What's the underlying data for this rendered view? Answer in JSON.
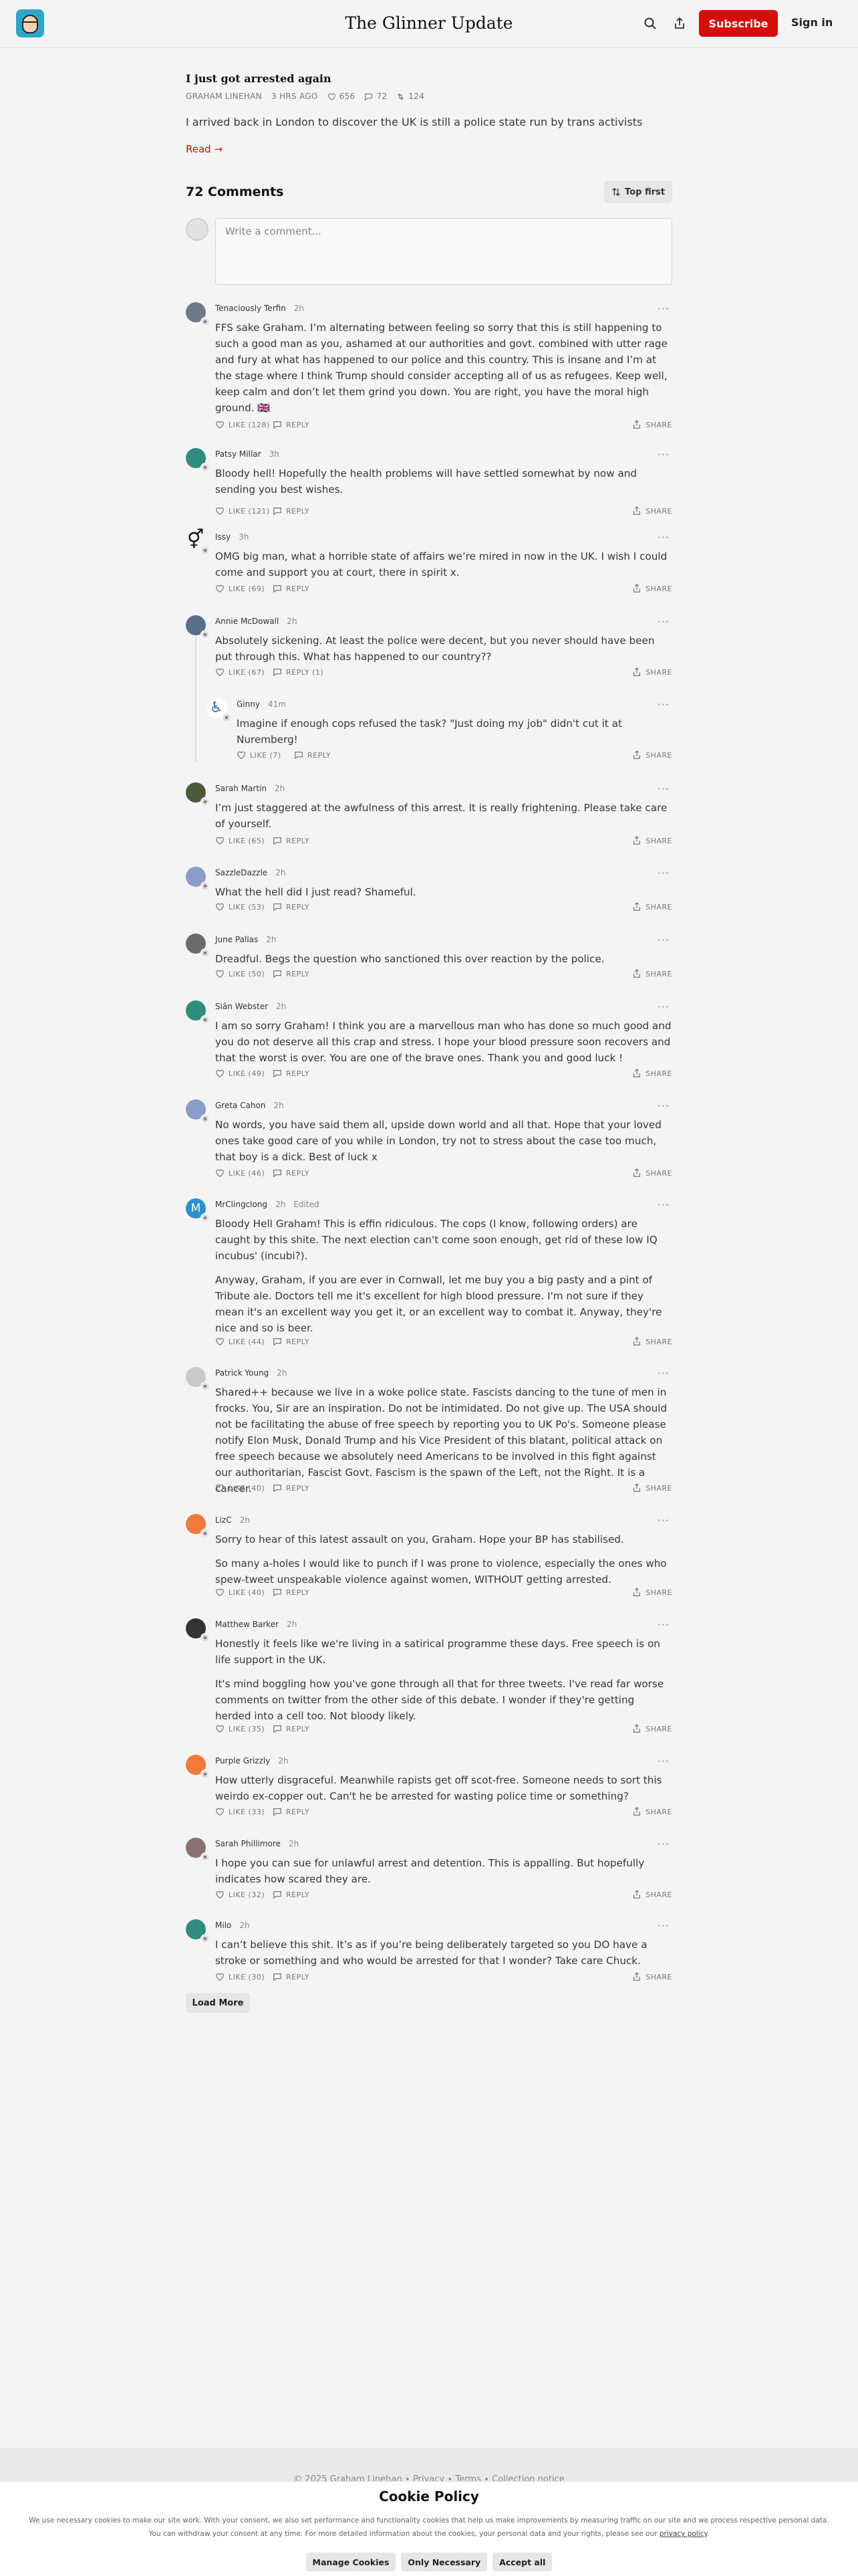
{
  "header": {
    "title": "The Glinner Update",
    "subscribe_label": "Subscribe",
    "signin_label": "Sign in"
  },
  "post": {
    "title": "I just got arrested again",
    "author": "GRAHAM LINEHAN",
    "time": "3 HRS AGO",
    "likes": "656",
    "comments": "72",
    "restacks": "124",
    "subtitle": "I arrived back in London to discover the UK is still a police state run by trans activists",
    "read_more": "Read →"
  },
  "comments_section": {
    "heading": "72 Comments",
    "sort_label": "Top first",
    "composer_placeholder": "Write a comment..."
  },
  "comments": [
    {
      "name": "Tenaciously Terfin",
      "time": "2h",
      "paragraphs": [
        "FFS sake Graham. I’m alternating between feeling so sorry that this is still happening to such a good man as you, ashamed at our authorities and govt. combined with utter rage and fury at what has happened to our police and this country. This is insane and I’m at the stage where I think Trump should consider accepting all of us as refugees. Keep well, keep calm and don’t let them grind you down. You are right, you have the moral high ground. 🇬🇧"
      ],
      "like": "LIKE (128)",
      "reply": "REPLY",
      "share": "SHARE"
    },
    {
      "name": "Patsy Millar",
      "time": "3h",
      "paragraphs": [
        "Bloody hell! Hopefully the health problems will have settled somewhat by now and sending you best wishes."
      ],
      "like": "LIKE (121)",
      "reply": "REPLY",
      "share": "SHARE"
    },
    {
      "name": "Issy",
      "time": "3h",
      "paragraphs": [
        "OMG big man, what a horrible state of affairs we’re mired in now in the UK. I wish I could come and support you at court, there in spirit x."
      ],
      "like": "LIKE (69)",
      "reply": "REPLY",
      "share": "SHARE"
    },
    {
      "name": "Annie McDowall",
      "time": "2h",
      "paragraphs": [
        "Absolutely sickening. At least the police were decent, but you never should have been put through this. What has happened to our country??"
      ],
      "like": "LIKE (67)",
      "reply": "REPLY (1)",
      "share": "SHARE"
    },
    {
      "name": "Ginny",
      "time": "41m",
      "paragraphs": [
        "Imagine if enough cops refused the task? \"Just doing my job\" didn't cut it at Nuremberg!"
      ],
      "like": "LIKE (7)",
      "reply": "REPLY",
      "share": "SHARE"
    },
    {
      "name": "Sarah Martin",
      "time": "2h",
      "paragraphs": [
        "I’m just staggered at the awfulness of this arrest. It is really frightening. Please take care of yourself."
      ],
      "like": "LIKE (65)",
      "reply": "REPLY",
      "share": "SHARE"
    },
    {
      "name": "SazzleDazzle",
      "time": "2h",
      "paragraphs": [
        "What the hell did I just read? Shameful."
      ],
      "like": "LIKE (53)",
      "reply": "REPLY",
      "share": "SHARE"
    },
    {
      "name": "June Pallas",
      "time": "2h",
      "paragraphs": [
        "Dreadful. Begs the question who sanctioned this over reaction by the police."
      ],
      "like": "LIKE (50)",
      "reply": "REPLY",
      "share": "SHARE"
    },
    {
      "name": "Siân Webster",
      "time": "2h",
      "paragraphs": [
        "I am so sorry Graham! I think you are a marvellous man who has done so much good and you do not deserve all this crap and stress. I hope your blood pressure soon recovers and that the worst is over. You are one of the brave ones. Thank you and good luck !"
      ],
      "like": "LIKE (49)",
      "reply": "REPLY",
      "share": "SHARE"
    },
    {
      "name": "Greta Cahon",
      "time": "2h",
      "paragraphs": [
        "No words, you have said them all, upside down world and all that. Hope that your loved ones take good care of you while in London, try not to stress about the case too much, that boy is a dick. Best of luck x"
      ],
      "like": "LIKE (46)",
      "reply": "REPLY",
      "share": "SHARE"
    },
    {
      "name": "MrClingclong",
      "time": "2h",
      "edited": "Edited",
      "paragraphs": [
        "Bloody Hell Graham! This is effin ridiculous. The cops (I know, following orders) are caught by this shite. The next election can't come soon enough, get rid of these low IQ incubus' (incubi?).",
        "Anyway, Graham, if you are ever in Cornwall, let me buy you a big pasty and a pint of Tribute ale. Doctors tell me it's excellent for high blood pressure. I'm not sure if they mean it's an excellent way you get it, or an excellent way to combat it. Anyway, they're nice and so is beer."
      ],
      "like": "LIKE (44)",
      "reply": "REPLY",
      "share": "SHARE"
    },
    {
      "name": "Patrick Young",
      "time": "2h",
      "paragraphs": [
        "Shared++ because we live in a woke police state. Fascists dancing to the tune of men in frocks. You, Sir are an inspiration. Do not be intimidated. Do not give up. The USA should not be facilitating the abuse of free speech by reporting you to UK Po's. Someone please notify Elon Musk, Donald Trump and his Vice President of this blatant, political attack on free speech because we absolutely need Americans to be involved in this fight against our authoritarian, Fascist Govt. Fascism is the spawn of the Left, not the Right. It is a cancer."
      ],
      "like": "LIKE (40)",
      "reply": "REPLY",
      "share": "SHARE"
    },
    {
      "name": "LizC",
      "time": "2h",
      "paragraphs": [
        "Sorry to hear of this latest assault on you, Graham. Hope your BP has stabilised.",
        "So many a-holes I would like to punch if I was prone to violence, especially the ones who spew-tweet unspeakable violence against women, WITHOUT getting arrested."
      ],
      "like": "LIKE (40)",
      "reply": "REPLY",
      "share": "SHARE"
    },
    {
      "name": "Matthew Barker",
      "time": "2h",
      "paragraphs": [
        "Honestly it feels like we're living in a satirical programme these days. Free speech is on life support in the UK.",
        "It's mind boggling how you've gone through all that for three tweets. I've read far worse comments on twitter from the other side of this debate. I wonder if they're getting herded into a cell too. Not bloody likely."
      ],
      "like": "LIKE (35)",
      "reply": "REPLY",
      "share": "SHARE"
    },
    {
      "name": "Purple Grizzly",
      "time": "2h",
      "paragraphs": [
        "How utterly disgraceful. Meanwhile rapists get off scot-free. Someone needs to sort this weirdo ex-copper out. Can't he be arrested for wasting police time or something?"
      ],
      "like": "LIKE (33)",
      "reply": "REPLY",
      "share": "SHARE"
    },
    {
      "name": "Sarah Phillimore",
      "time": "2h",
      "paragraphs": [
        "I hope you can sue for unlawful arrest and detention. This is appalling. But hopefully indicates how scared they are."
      ],
      "like": "LIKE (32)",
      "reply": "REPLY",
      "share": "SHARE"
    },
    {
      "name": "Milo",
      "time": "2h",
      "paragraphs": [
        "I can’t believe this shit. It’s as if you’re being deliberately targeted so you DO have a stroke or something and who would be arrested for that I wonder? Take care Chuck."
      ],
      "like": "LIKE (30)",
      "reply": "REPLY",
      "share": "SHARE"
    }
  ],
  "load_more": "Load More",
  "footer": {
    "copyright": "© 2025 Graham Linehan",
    "privacy": "Privacy",
    "terms": "Terms",
    "collection": "Collection notice"
  },
  "cookie": {
    "title": "Cookie Policy",
    "text1": "We use necessary cookies to make our site work. With your consent, we also set performance and functionality cookies that help us make improvements by measuring traffic on our site and we process respective personal data.",
    "text2": "You can withdraw your consent at any time. For more detailed information about the cookies, your personal data and your rights, please see our",
    "policy_link": "privacy policy",
    "manage": "Manage Cookies",
    "necessary": "Only Necessary",
    "accept": "Accept all"
  },
  "colors": {
    "accent": "#d60d0d",
    "background": "#f4f4f5"
  }
}
